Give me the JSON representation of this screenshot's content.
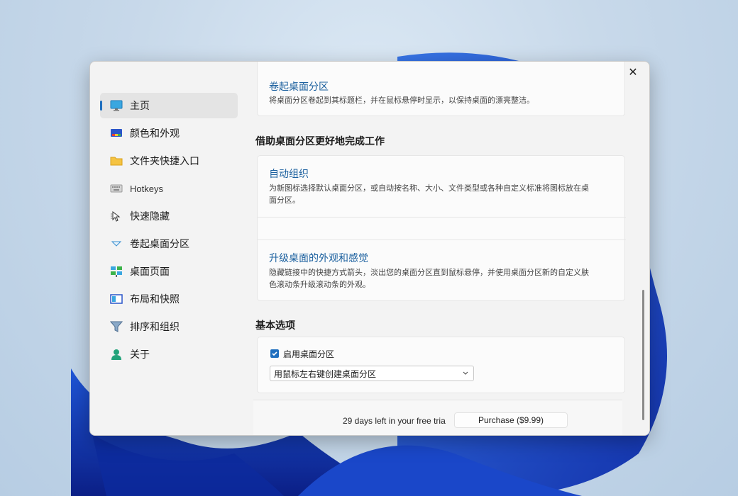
{
  "window": {
    "controls": {
      "minimize": "minimize-icon",
      "maximize": "maximize-icon",
      "close": "close-icon"
    }
  },
  "sidebar": {
    "items": [
      {
        "label": "主页",
        "icon": "monitor-icon",
        "active": true
      },
      {
        "label": "颜色和外观",
        "icon": "palette-icon",
        "active": false
      },
      {
        "label": "文件夹快捷入口",
        "icon": "folder-icon",
        "active": false
      },
      {
        "label": "Hotkeys",
        "icon": "keyboard-icon",
        "active": false
      },
      {
        "label": "快速隐藏",
        "icon": "cursor-hide-icon",
        "active": false
      },
      {
        "label": "卷起桌面分区",
        "icon": "chevron-down-icon",
        "active": false
      },
      {
        "label": "桌面页面",
        "icon": "desktop-pages-icon",
        "active": false
      },
      {
        "label": "布局和快照",
        "icon": "layout-icon",
        "active": false
      },
      {
        "label": "排序和组织",
        "icon": "filter-icon",
        "active": false
      },
      {
        "label": "关于",
        "icon": "person-icon",
        "active": false
      }
    ]
  },
  "content": {
    "rollup_card": {
      "title": "卷起桌面分区",
      "desc": "将桌面分区卷起到其标题栏，并在鼠标悬停时显示，以保持桌面的漂亮整洁。"
    },
    "section1_title": "借助桌面分区更好地完成工作",
    "feature_cards": [
      {
        "title": "自动组织",
        "desc": "为新图标选择默认桌面分区，或自动按名称、大小、文件类型或各种自定义标准将图标放在桌面分区。"
      },
      {
        "title": "升级桌面的外观和感觉",
        "desc": "隐藏链接中的快捷方式箭头，淡出您的桌面分区直到鼠标悬停，并使用桌面分区新的自定义肤色滚动条升级滚动条的外观。"
      }
    ],
    "section2_title": "基本选项",
    "options": {
      "enable_label": "启用桌面分区",
      "enable_checked": true,
      "create_select_value": "用鼠标左右键创建桌面分区"
    }
  },
  "footer": {
    "trial_text": "29 days left in your free tria",
    "purchase_label": "Purchase ($9.99)"
  },
  "colors": {
    "accent": "#1f6fbf",
    "link_title": "#1a5f9e"
  }
}
